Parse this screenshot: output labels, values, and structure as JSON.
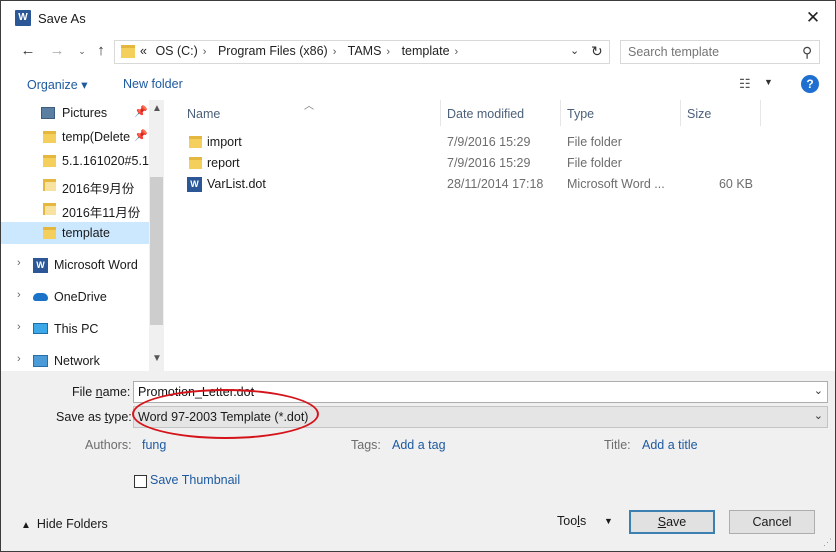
{
  "window": {
    "title": "Save As",
    "app_icon": "word-icon",
    "close_glyph": "✕"
  },
  "address": {
    "crumbs": [
      "«",
      "OS (C:)",
      "Program Files (x86)",
      "TAMS",
      "template"
    ],
    "search_placeholder": "Search template"
  },
  "toolbar": {
    "organize_label": "Organize ▾",
    "new_folder_label": "New folder",
    "help_label": "?"
  },
  "nav": {
    "items": [
      {
        "label": "Pictures",
        "icon": "pictures-icon",
        "pinned": true
      },
      {
        "label": "temp(Delete",
        "icon": "folder-icon",
        "pinned": true
      },
      {
        "label": "5.1.161020#5.1",
        "icon": "folder-icon",
        "pinned": false
      },
      {
        "label": "2016年9月份",
        "icon": "folder-icon",
        "pinned": false
      },
      {
        "label": "2016年11月份",
        "icon": "folder-icon",
        "pinned": false
      },
      {
        "label": "template",
        "icon": "folder-icon",
        "pinned": false,
        "selected": true
      },
      {
        "label": "Microsoft Word",
        "icon": "word-icon",
        "expandable": true
      },
      {
        "label": "OneDrive",
        "icon": "onedrive-icon",
        "expandable": true
      },
      {
        "label": "This PC",
        "icon": "pc-icon",
        "expandable": true
      },
      {
        "label": "Network",
        "icon": "network-icon",
        "expandable": true
      }
    ]
  },
  "filelist": {
    "columns": [
      "Name",
      "Date modified",
      "Type",
      "Size"
    ],
    "rows": [
      {
        "name": "import",
        "date": "7/9/2016 15:29",
        "type": "File folder",
        "size": "",
        "icon": "folder-icon"
      },
      {
        "name": "report",
        "date": "7/9/2016 15:29",
        "type": "File folder",
        "size": "",
        "icon": "folder-icon"
      },
      {
        "name": "VarList.dot",
        "date": "28/11/2014 17:18",
        "type": "Microsoft Word ...",
        "size": "60 KB",
        "icon": "word-doc-icon"
      }
    ]
  },
  "form": {
    "file_name_label_pre": "File ",
    "file_name_label_u": "n",
    "file_name_label_post": "ame:",
    "file_name_value": "Promotion_Letter.dot",
    "save_type_label_pre": "Save as ",
    "save_type_label_u": "t",
    "save_type_label_post": "ype:",
    "save_type_value": "Word 97-2003 Template (*.dot)",
    "authors_label": "Authors:",
    "authors_value": "fung",
    "tags_label": "Tags:",
    "tags_value": "Add a tag",
    "title_label": "Title:",
    "title_value": "Add a title",
    "save_thumbnail_label": "Save Thumbnail"
  },
  "footer": {
    "hide_folders_label": "Hide Folders",
    "tools_label_pre": "Too",
    "tools_label_u": "l",
    "tools_label_post": "s",
    "save_label_u": "S",
    "save_label_post": "ave",
    "cancel_label": "Cancel"
  },
  "colors": {
    "accent": "#1e5aa0",
    "selection": "#cce8ff",
    "annotation": "#d4141a"
  }
}
